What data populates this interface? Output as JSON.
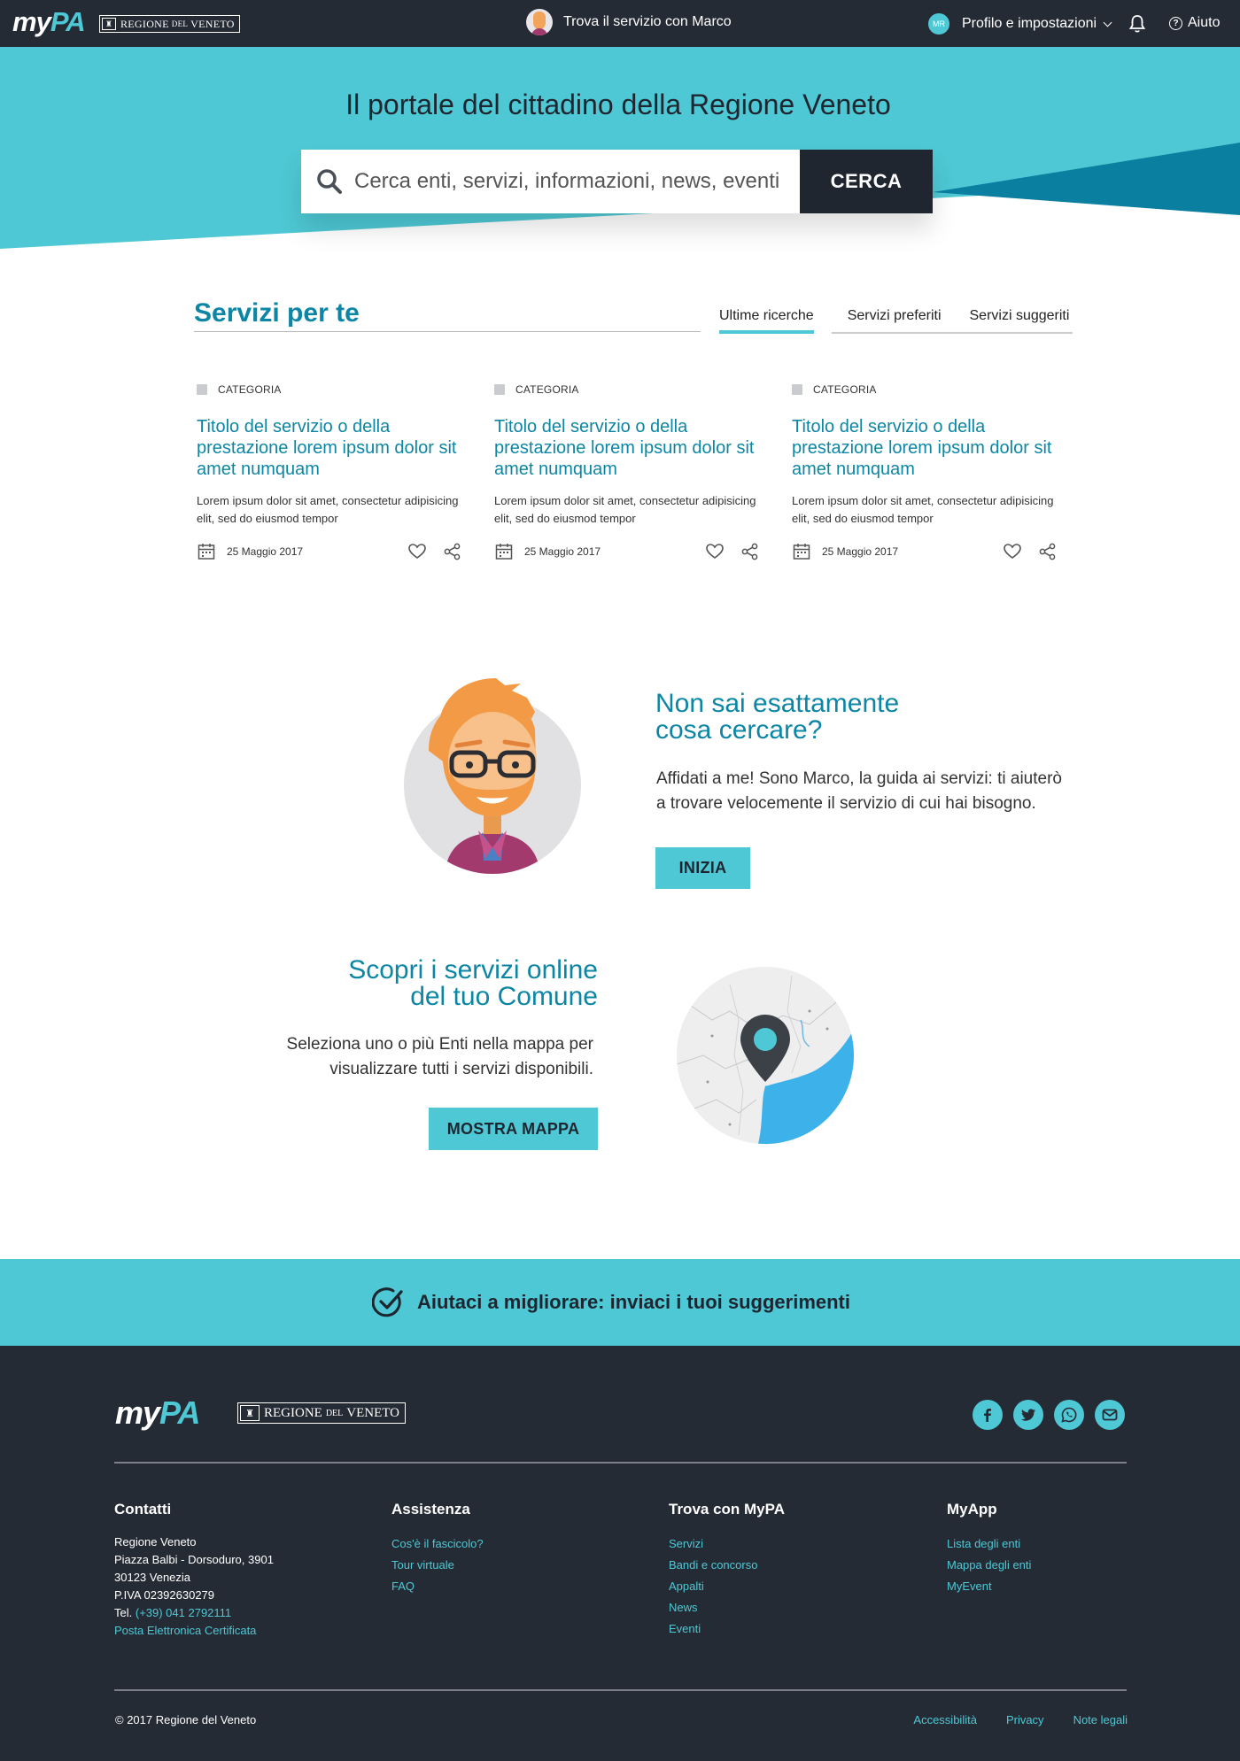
{
  "header": {
    "logo_my": "my",
    "logo_pa": "PA",
    "regione_prefix": "REGIONE",
    "regione_small": "DEL",
    "regione_suffix": "VENETO",
    "assistant_label": "Trova il servizio con Marco",
    "profile_initials": "MR",
    "profile_label": "Profilo e impostazioni",
    "help_label": "Aiuto",
    "icons": [
      "avatar-icon",
      "chevron-down-icon",
      "bell-icon",
      "help-icon"
    ]
  },
  "hero": {
    "title": "Il portale del cittadino della Regione Veneto",
    "search_placeholder": "Cerca enti, servizi, informazioni, news, eventi",
    "search_button": "CERCA",
    "colors": {
      "light": "#4ec8d4",
      "dark": "#0b7fa0"
    }
  },
  "services": {
    "title": "Servizi per te",
    "tabs": [
      "Ultime ricerche",
      "Servizi preferiti",
      "Servizi suggeriti"
    ],
    "active_tab": "Ultime ricerche",
    "cards": [
      {
        "category": "CATEGORIA",
        "title": "Titolo del servizio o della prestazione lorem ipsum dolor sit amet numquam",
        "text": "Lorem ipsum dolor sit amet, consectetur adipisicing elit, sed do eiusmod tempor",
        "date": "25 Maggio 2017"
      },
      {
        "category": "CATEGORIA",
        "title": "Titolo del servizio o della prestazione lorem ipsum dolor sit amet numquam",
        "text": "Lorem ipsum dolor sit amet, consectetur adipisicing elit, sed do eiusmod tempor",
        "date": "25 Maggio 2017"
      },
      {
        "category": "CATEGORIA",
        "title": "Titolo del servizio o della prestazione lorem ipsum dolor sit amet numquam",
        "text": "Lorem ipsum dolor sit amet, consectetur adipisicing elit, sed do eiusmod tempor",
        "date": "25 Maggio 2017"
      }
    ]
  },
  "guide": {
    "title_line1": "Non sai esattamente",
    "title_line2": "cosa cercare?",
    "text": "Affidati a me! Sono Marco, la guida ai servizi: ti aiuterò a trovare velocemente il servizio di cui hai bisogno.",
    "button": "INIZIA"
  },
  "map_section": {
    "title_line1": "Scopri i servizi online",
    "title_line2": "del tuo Comune",
    "text": "Seleziona uno o più Enti nella mappa per visualizzare tutti i servizi disponibili.",
    "button": "MOSTRA MAPPA"
  },
  "feedback": {
    "text": "Aiutaci a migliorare: inviaci i tuoi suggerimenti"
  },
  "footer": {
    "socials": [
      "facebook-icon",
      "twitter-icon",
      "whatsapp-icon",
      "mail-icon"
    ],
    "contacts": {
      "title": "Contatti",
      "lines": [
        "Regione Veneto",
        "Piazza Balbi - Dorsoduro, 3901",
        "30123 Venezia",
        "P.IVA 02392630279"
      ],
      "tel_prefix": "Tel.",
      "tel": "(+39) 041 2792111",
      "pec": "Posta Elettronica Certificata"
    },
    "assistenza": {
      "title": "Assistenza",
      "links": [
        "Cos'è il fascicolo?",
        "Tour virtuale",
        "FAQ"
      ]
    },
    "trova": {
      "title": "Trova con MyPA",
      "links": [
        "Servizi",
        "Bandi e concorso",
        "Appalti",
        "News",
        "Eventi"
      ]
    },
    "myapp": {
      "title": "MyApp",
      "links": [
        "Lista degli enti",
        "Mappa degli enti",
        "MyEvent"
      ]
    },
    "copyright": "© 2017 Regione del Veneto",
    "bottom_links": [
      "Accessibilità",
      "Privacy",
      "Note legali"
    ]
  }
}
